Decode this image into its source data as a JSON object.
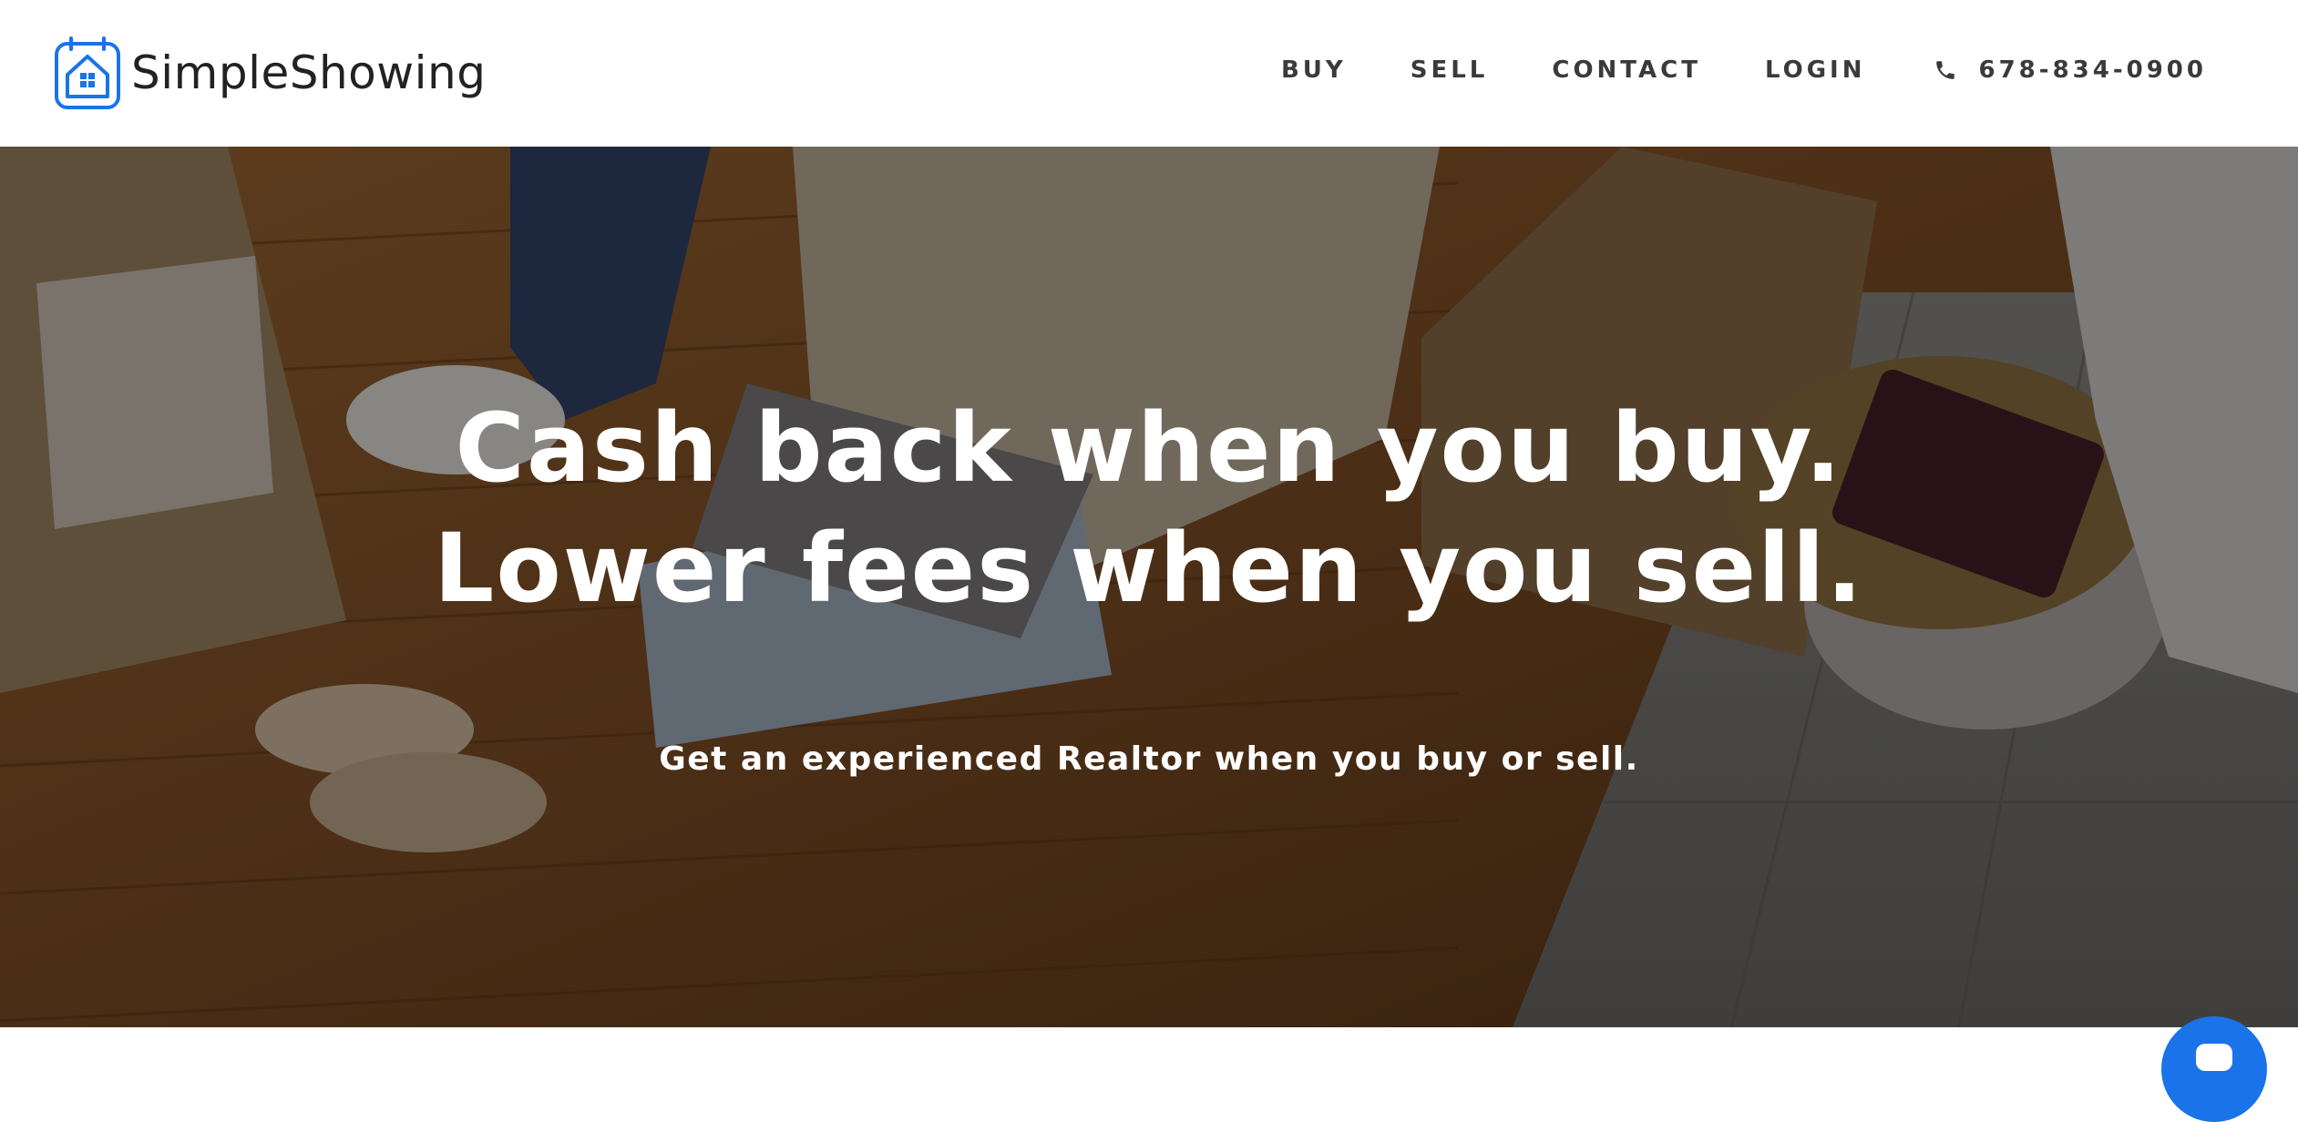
{
  "brand": {
    "name": "SimpleShowing",
    "logo_icon": "house-calendar-icon",
    "accent_color": "#1a73e8"
  },
  "nav": {
    "items": [
      {
        "label": "BUY"
      },
      {
        "label": "SELL"
      },
      {
        "label": "CONTACT"
      },
      {
        "label": "LOGIN"
      }
    ],
    "phone": {
      "icon": "phone-icon",
      "number": "678-834-0900"
    }
  },
  "hero": {
    "title_line1": "Cash back when you buy.",
    "title_line2": "Lower fees when you sell.",
    "subtitle": "Get an experienced Realtor when you buy or sell.",
    "background": "photo-couple-moving-boxes-laptop"
  },
  "chat": {
    "icon": "chat-bubble-icon"
  }
}
